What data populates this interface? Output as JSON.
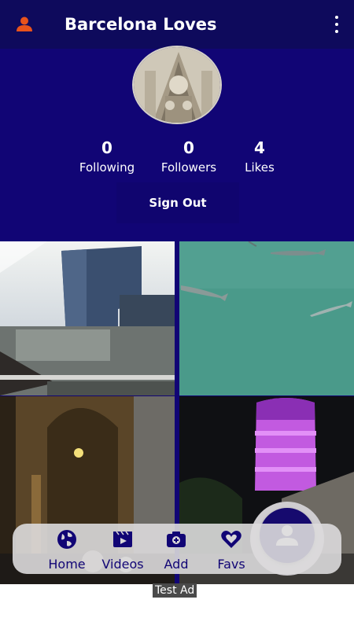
{
  "appbar": {
    "title": "Barcelona Loves"
  },
  "profile": {
    "stats": [
      {
        "value": "0",
        "label": "Following"
      },
      {
        "value": "0",
        "label": "Followers"
      },
      {
        "value": "4",
        "label": "Likes"
      }
    ],
    "sign_out_label": "Sign Out"
  },
  "nav": {
    "items": [
      {
        "label": "Home",
        "icon": "globe-icon"
      },
      {
        "label": "Videos",
        "icon": "video-icon"
      },
      {
        "label": "Add",
        "icon": "camera-add-icon"
      },
      {
        "label": "Favs",
        "icon": "heart-icon"
      }
    ],
    "fab_icon": "profile-icon"
  },
  "ad": {
    "label": "Test Ad"
  },
  "colors": {
    "primary": "#110575",
    "accent": "#e8531c",
    "appbar": "#0e0a5c"
  }
}
